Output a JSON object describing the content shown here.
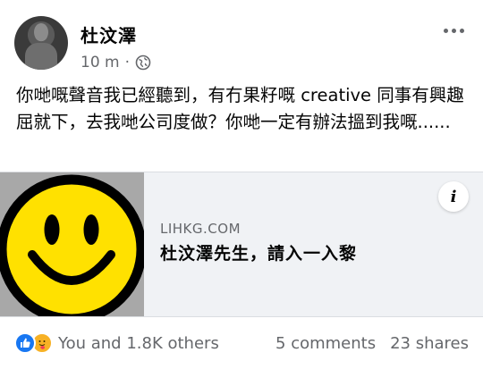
{
  "post": {
    "author": "杜汶澤",
    "time": "10 m",
    "separator": "·",
    "privacy_icon": "globe-icon",
    "text": "你哋嘅聲音我已經聽到，有冇果籽嘅 creative 同事有興趣屈就下，去我哋公司度做？你哋一定有辦法搵到我嘅......"
  },
  "link_card": {
    "domain": "LIHKG.COM",
    "title": "杜汶澤先生，請入一入黎",
    "info_label": "i",
    "thumbnail_icon": "smiley-face-icon"
  },
  "footer": {
    "reactions_text": "You and 1.8K others",
    "comments": "5 comments",
    "shares": "23 shares"
  },
  "colors": {
    "text_primary": "#050505",
    "text_secondary": "#65676b",
    "like_blue": "#1877f2",
    "card_background": "#f0f2f5",
    "smiley_yellow": "#ffe100"
  }
}
